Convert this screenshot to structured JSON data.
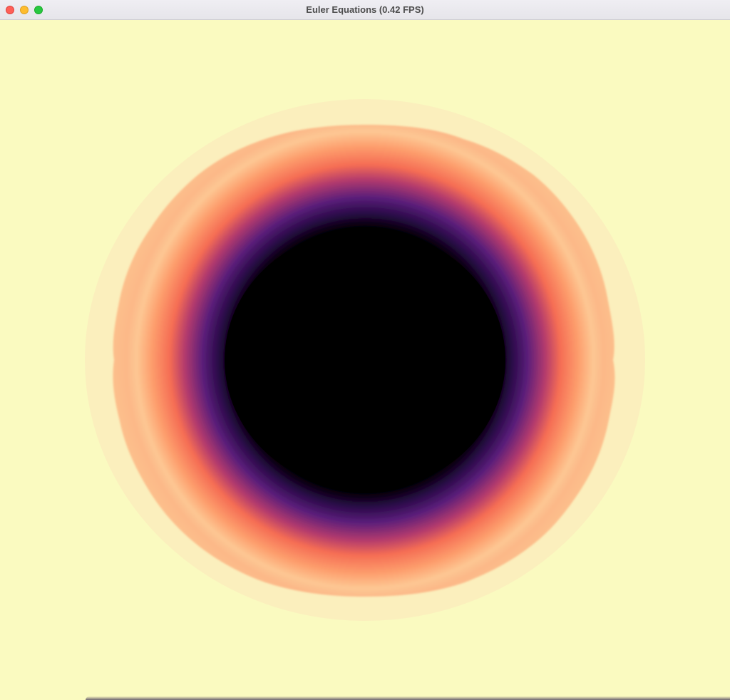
{
  "window": {
    "title": "Euler Equations (0.42 FPS)"
  },
  "colors": {
    "background": "#fafac0",
    "halo": "#fbefbd",
    "outer_ring": "#fdc793",
    "mid_ring": "#f56d54",
    "inner_ring": "#5a1e7a",
    "core": "#000000"
  },
  "icons": {
    "close": "close-traffic-light-icon",
    "minimize": "minimize-traffic-light-icon",
    "maximize": "maximize-traffic-light-icon"
  }
}
